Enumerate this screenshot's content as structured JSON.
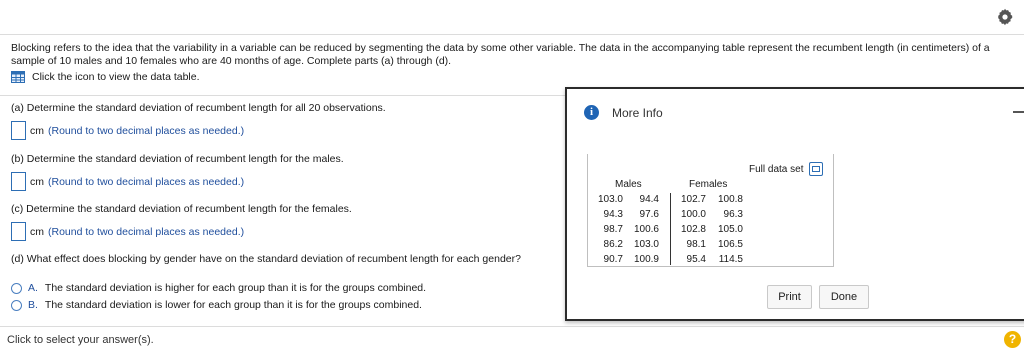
{
  "header": {
    "settings_icon": "gear-icon"
  },
  "problem": {
    "text": "Blocking refers to the idea that the variability in a variable can be reduced by segmenting the data by some other variable. The data in the accompanying table represent the recumbent length (in centimeters) of a sample of 10 males and 10 females who are 40 months of age. Complete parts (a) through (d).",
    "data_link": "Click the icon to view the data table."
  },
  "questions": {
    "a": {
      "text": "(a) Determine the standard deviation of recumbent length for all 20 observations.",
      "unit": "cm",
      "hint": "(Round to two decimal places as needed.)"
    },
    "b": {
      "text": "(b) Determine the standard deviation of recumbent length for the males.",
      "unit": "cm",
      "hint": "(Round to two decimal places as needed.)"
    },
    "c": {
      "text": "(c) Determine the standard deviation of recumbent length for the females.",
      "unit": "cm",
      "hint": "(Round to two decimal places as needed.)"
    },
    "d": {
      "text": "(d) What effect does blocking by gender have on the standard deviation of recumbent length for each gender?",
      "options": [
        {
          "letter": "A.",
          "text": "The standard deviation is higher for each group than it is for the groups combined."
        },
        {
          "letter": "B.",
          "text": "The standard deviation is lower for each group than it is for the groups combined."
        }
      ]
    }
  },
  "footer": {
    "text": "Click to select your answer(s).",
    "help": "?"
  },
  "panel": {
    "title": "More Info",
    "full_data_label": "Full data set",
    "males_label": "Males",
    "females_label": "Females",
    "males": [
      [
        "103.0",
        "94.4"
      ],
      [
        "94.3",
        "97.6"
      ],
      [
        "98.7",
        "100.6"
      ],
      [
        "86.2",
        "103.0"
      ],
      [
        "90.7",
        "100.9"
      ]
    ],
    "females": [
      [
        "102.7",
        "100.8"
      ],
      [
        "100.0",
        "96.3"
      ],
      [
        "102.8",
        "105.0"
      ],
      [
        "98.1",
        "106.5"
      ],
      [
        "95.4",
        "114.5"
      ]
    ],
    "print_label": "Print",
    "done_label": "Done"
  }
}
